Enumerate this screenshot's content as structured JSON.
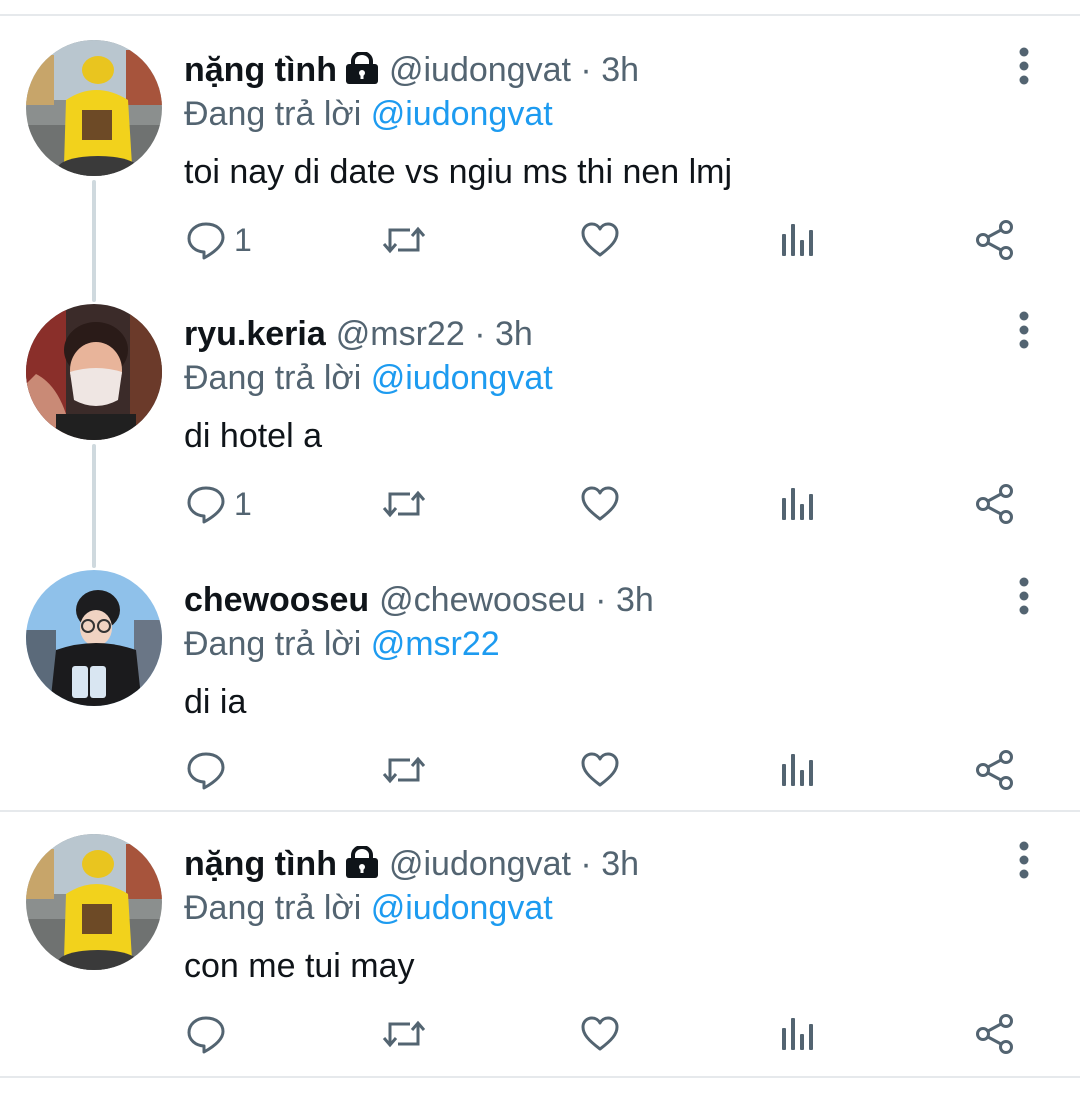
{
  "tweets": [
    {
      "name": "nặng tình",
      "locked": true,
      "handle": "@iudongvat",
      "dot": "·",
      "time": "3h",
      "reply_prefix": "Đang trả lời",
      "reply_to": "@iudongvat",
      "text": "toi nay di date vs ngiu ms thi nen lmj",
      "reply_count": "1",
      "avatar": "avatar-yellow-shirt-rider"
    },
    {
      "name": "ryu.keria",
      "locked": false,
      "handle": "@msr22",
      "dot": "·",
      "time": "3h",
      "reply_prefix": "Đang trả lời",
      "reply_to": "@iudongvat",
      "text": "di hotel a",
      "reply_count": "1",
      "avatar": "avatar-masked-person"
    },
    {
      "name": "chewooseu",
      "locked": false,
      "handle": "@chewooseu",
      "dot": "·",
      "time": "3h",
      "reply_prefix": "Đang trả lời",
      "reply_to": "@msr22",
      "text": "di ia",
      "reply_count": "",
      "avatar": "avatar-person-in-chair"
    },
    {
      "name": "nặng tình",
      "locked": true,
      "handle": "@iudongvat",
      "dot": "·",
      "time": "3h",
      "reply_prefix": "Đang trả lời",
      "reply_to": "@iudongvat",
      "text": "con me tui may",
      "reply_count": "",
      "avatar": "avatar-yellow-shirt-rider"
    }
  ],
  "icons": {
    "reply": "reply-icon",
    "retweet": "retweet-icon",
    "like": "heart-icon",
    "views": "analytics-icon",
    "share": "share-icon",
    "more": "more-options-icon",
    "lock": "lock-icon"
  },
  "colors": {
    "text": "#0f1419",
    "secondary": "#536471",
    "accent": "#1d9bf0",
    "divider": "#e6e9ec",
    "thread_line": "#cfd9de"
  }
}
